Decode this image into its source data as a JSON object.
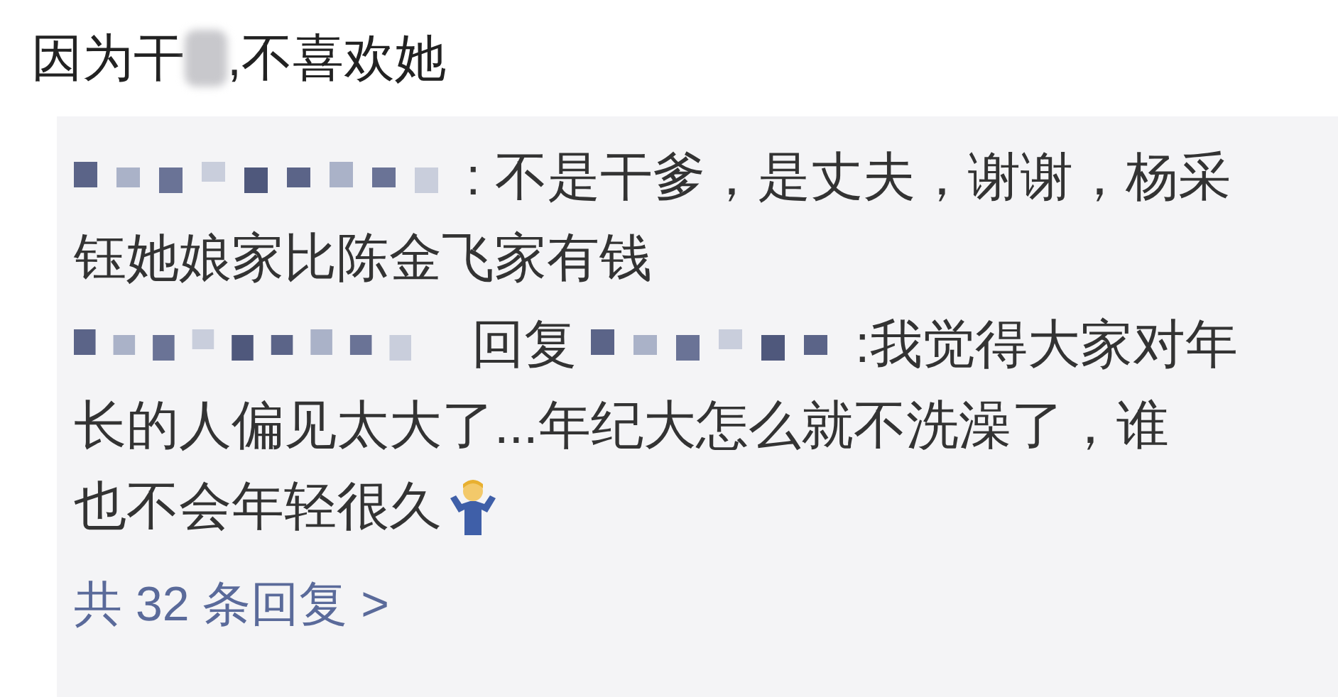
{
  "title": {
    "before": "因为干",
    "after": ",不喜欢她"
  },
  "comments": [
    {
      "kind": "comment",
      "lines": [
        ": 不是干爹，是丈夫，谢谢，杨采",
        "钰她娘家比陈金飞家有钱"
      ]
    },
    {
      "kind": "reply",
      "reply_word": "回复",
      "lines": [
        ":我觉得大家对年",
        "长的人偏见太大了...年纪大怎么就不洗澡了，谁",
        "也不会年轻很久"
      ],
      "emoji": true
    }
  ],
  "replies_link": "共 32 条回复 >"
}
